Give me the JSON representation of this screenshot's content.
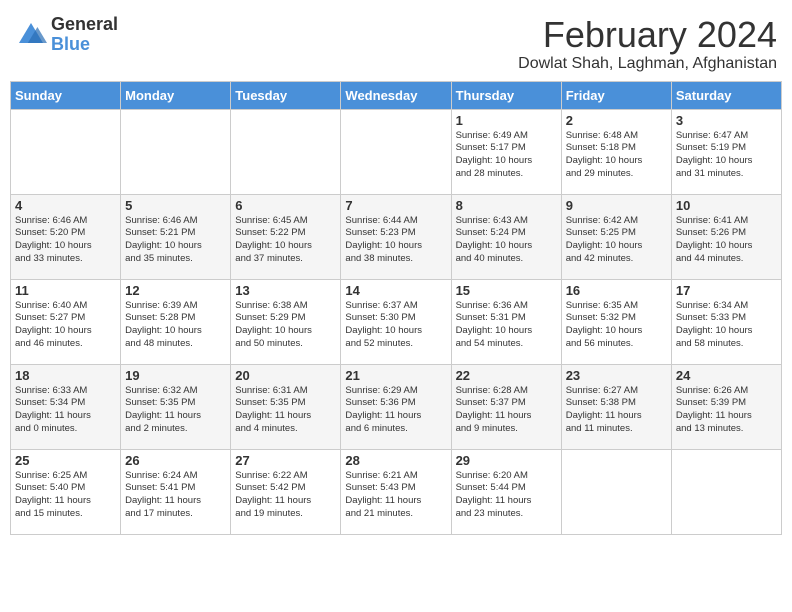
{
  "logo": {
    "general": "General",
    "blue": "Blue"
  },
  "title": "February 2024",
  "location": "Dowlat Shah, Laghman, Afghanistan",
  "weekdays": [
    "Sunday",
    "Monday",
    "Tuesday",
    "Wednesday",
    "Thursday",
    "Friday",
    "Saturday"
  ],
  "weeks": [
    [
      {
        "day": "",
        "info": ""
      },
      {
        "day": "",
        "info": ""
      },
      {
        "day": "",
        "info": ""
      },
      {
        "day": "",
        "info": ""
      },
      {
        "day": "1",
        "info": "Sunrise: 6:49 AM\nSunset: 5:17 PM\nDaylight: 10 hours\nand 28 minutes."
      },
      {
        "day": "2",
        "info": "Sunrise: 6:48 AM\nSunset: 5:18 PM\nDaylight: 10 hours\nand 29 minutes."
      },
      {
        "day": "3",
        "info": "Sunrise: 6:47 AM\nSunset: 5:19 PM\nDaylight: 10 hours\nand 31 minutes."
      }
    ],
    [
      {
        "day": "4",
        "info": "Sunrise: 6:46 AM\nSunset: 5:20 PM\nDaylight: 10 hours\nand 33 minutes."
      },
      {
        "day": "5",
        "info": "Sunrise: 6:46 AM\nSunset: 5:21 PM\nDaylight: 10 hours\nand 35 minutes."
      },
      {
        "day": "6",
        "info": "Sunrise: 6:45 AM\nSunset: 5:22 PM\nDaylight: 10 hours\nand 37 minutes."
      },
      {
        "day": "7",
        "info": "Sunrise: 6:44 AM\nSunset: 5:23 PM\nDaylight: 10 hours\nand 38 minutes."
      },
      {
        "day": "8",
        "info": "Sunrise: 6:43 AM\nSunset: 5:24 PM\nDaylight: 10 hours\nand 40 minutes."
      },
      {
        "day": "9",
        "info": "Sunrise: 6:42 AM\nSunset: 5:25 PM\nDaylight: 10 hours\nand 42 minutes."
      },
      {
        "day": "10",
        "info": "Sunrise: 6:41 AM\nSunset: 5:26 PM\nDaylight: 10 hours\nand 44 minutes."
      }
    ],
    [
      {
        "day": "11",
        "info": "Sunrise: 6:40 AM\nSunset: 5:27 PM\nDaylight: 10 hours\nand 46 minutes."
      },
      {
        "day": "12",
        "info": "Sunrise: 6:39 AM\nSunset: 5:28 PM\nDaylight: 10 hours\nand 48 minutes."
      },
      {
        "day": "13",
        "info": "Sunrise: 6:38 AM\nSunset: 5:29 PM\nDaylight: 10 hours\nand 50 minutes."
      },
      {
        "day": "14",
        "info": "Sunrise: 6:37 AM\nSunset: 5:30 PM\nDaylight: 10 hours\nand 52 minutes."
      },
      {
        "day": "15",
        "info": "Sunrise: 6:36 AM\nSunset: 5:31 PM\nDaylight: 10 hours\nand 54 minutes."
      },
      {
        "day": "16",
        "info": "Sunrise: 6:35 AM\nSunset: 5:32 PM\nDaylight: 10 hours\nand 56 minutes."
      },
      {
        "day": "17",
        "info": "Sunrise: 6:34 AM\nSunset: 5:33 PM\nDaylight: 10 hours\nand 58 minutes."
      }
    ],
    [
      {
        "day": "18",
        "info": "Sunrise: 6:33 AM\nSunset: 5:34 PM\nDaylight: 11 hours\nand 0 minutes."
      },
      {
        "day": "19",
        "info": "Sunrise: 6:32 AM\nSunset: 5:35 PM\nDaylight: 11 hours\nand 2 minutes."
      },
      {
        "day": "20",
        "info": "Sunrise: 6:31 AM\nSunset: 5:35 PM\nDaylight: 11 hours\nand 4 minutes."
      },
      {
        "day": "21",
        "info": "Sunrise: 6:29 AM\nSunset: 5:36 PM\nDaylight: 11 hours\nand 6 minutes."
      },
      {
        "day": "22",
        "info": "Sunrise: 6:28 AM\nSunset: 5:37 PM\nDaylight: 11 hours\nand 9 minutes."
      },
      {
        "day": "23",
        "info": "Sunrise: 6:27 AM\nSunset: 5:38 PM\nDaylight: 11 hours\nand 11 minutes."
      },
      {
        "day": "24",
        "info": "Sunrise: 6:26 AM\nSunset: 5:39 PM\nDaylight: 11 hours\nand 13 minutes."
      }
    ],
    [
      {
        "day": "25",
        "info": "Sunrise: 6:25 AM\nSunset: 5:40 PM\nDaylight: 11 hours\nand 15 minutes."
      },
      {
        "day": "26",
        "info": "Sunrise: 6:24 AM\nSunset: 5:41 PM\nDaylight: 11 hours\nand 17 minutes."
      },
      {
        "day": "27",
        "info": "Sunrise: 6:22 AM\nSunset: 5:42 PM\nDaylight: 11 hours\nand 19 minutes."
      },
      {
        "day": "28",
        "info": "Sunrise: 6:21 AM\nSunset: 5:43 PM\nDaylight: 11 hours\nand 21 minutes."
      },
      {
        "day": "29",
        "info": "Sunrise: 6:20 AM\nSunset: 5:44 PM\nDaylight: 11 hours\nand 23 minutes."
      },
      {
        "day": "",
        "info": ""
      },
      {
        "day": "",
        "info": ""
      }
    ]
  ],
  "colors": {
    "header_bg": "#4a90d9",
    "header_text": "#ffffff",
    "accent": "#4a90d9"
  }
}
